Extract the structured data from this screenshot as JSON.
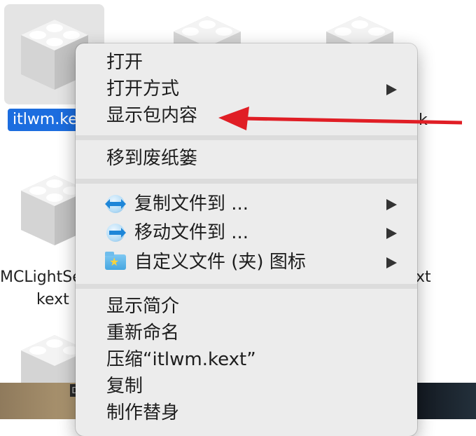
{
  "files": [
    {
      "label": "itlwm.kext",
      "visible_label": "itlwm.ke",
      "selected": true,
      "icon": "kext-bundle-icon"
    },
    {
      "label_line1": "MCLightSe",
      "label_line2": "kext",
      "icon": "kext-bundle-icon"
    },
    {
      "label_fragment": "k",
      "icon": "kext-bundle-icon"
    },
    {
      "label_fragment": "xt",
      "icon": "kext-bundle-icon"
    }
  ],
  "context_menu": {
    "group1": [
      {
        "label": "打开"
      },
      {
        "label": "打开方式",
        "has_submenu": true
      },
      {
        "label": "显示包内容",
        "annotated": true
      }
    ],
    "group2": [
      {
        "label": "移到废纸篓"
      }
    ],
    "group3": [
      {
        "label": "复制文件到 ...",
        "icon": "copy-to-icon",
        "has_submenu": true
      },
      {
        "label": "移动文件到 ...",
        "icon": "move-to-icon",
        "has_submenu": true
      },
      {
        "label": "自定义文件 (夹) 图标",
        "icon": "folder-star-icon",
        "has_submenu": true
      }
    ],
    "group4": [
      {
        "label": "显示简介"
      },
      {
        "label": "重新命名"
      },
      {
        "label": "压缩“itlwm.kext”"
      },
      {
        "label": "复制"
      },
      {
        "label": "制作替身"
      }
    ]
  },
  "annotation": {
    "color": "#e01e25",
    "points_to": "显示包内容"
  },
  "dock_tag": "D",
  "colors": {
    "selection": "#1c6ddf",
    "menu_bg": "#ececec"
  }
}
